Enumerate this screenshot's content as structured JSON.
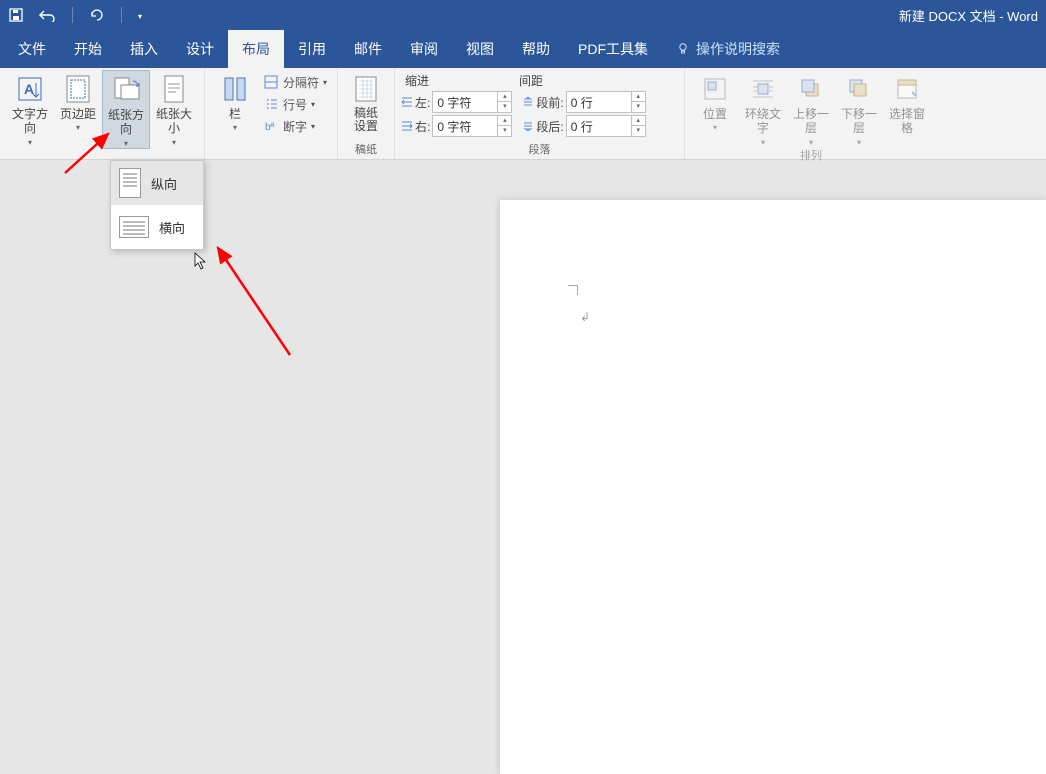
{
  "title": "新建 DOCX 文档 - Word",
  "tabs": {
    "file": "文件",
    "home": "开始",
    "insert": "插入",
    "design": "设计",
    "layout": "布局",
    "references": "引用",
    "mail": "邮件",
    "review": "审阅",
    "view": "视图",
    "help": "帮助",
    "pdf": "PDF工具集",
    "tellme": "操作说明搜索"
  },
  "ribbon": {
    "page_setup": {
      "text_direction": "文字方向",
      "margins": "页边距",
      "orientation": "纸张方向",
      "size": "纸张大小",
      "columns": "栏",
      "breaks": "分隔符",
      "line_numbers": "行号",
      "hyphenation": "断字"
    },
    "manuscript": {
      "btn": "稿纸设置",
      "label": "稿纸"
    },
    "paragraph": {
      "indent_label": "缩进",
      "spacing_label": "间距",
      "left_label": "左:",
      "right_label": "右:",
      "before_label": "段前:",
      "after_label": "段后:",
      "left_value": "0 字符",
      "right_value": "0 字符",
      "before_value": "0 行",
      "after_value": "0 行",
      "group_label": "段落"
    },
    "arrange": {
      "position": "位置",
      "wrap": "环绕文字",
      "forward": "上移一层",
      "backward": "下移一层",
      "selection_pane": "选择窗格",
      "group_label": "排列"
    }
  },
  "orientation_menu": {
    "portrait": "纵向",
    "landscape": "横向"
  }
}
